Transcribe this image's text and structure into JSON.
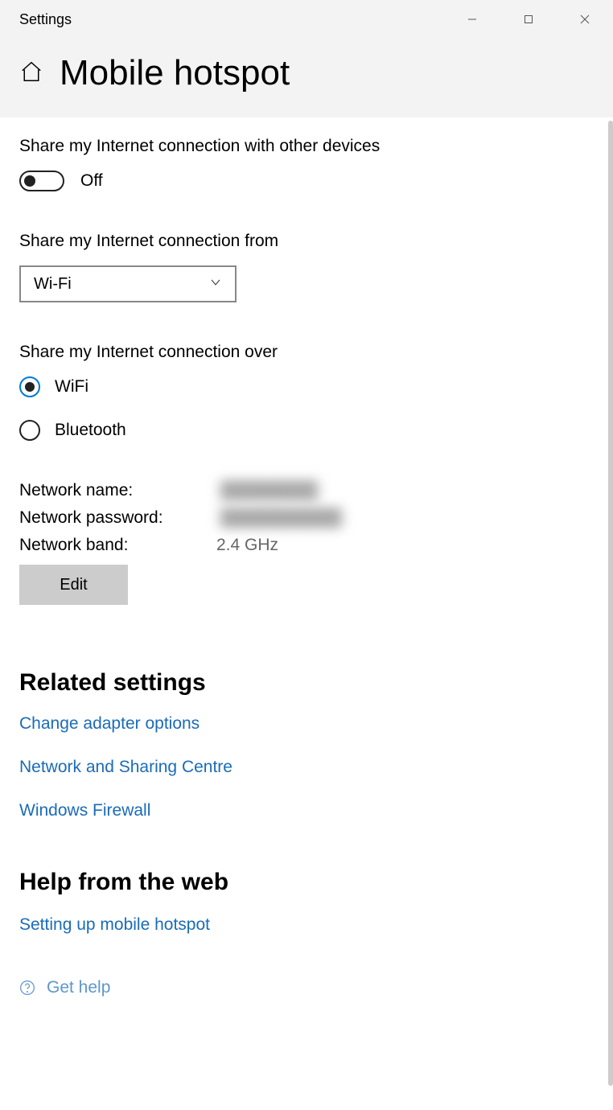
{
  "window_title": "Settings",
  "page_title": "Mobile hotspot",
  "share_with_devices": {
    "label": "Share my Internet connection with other devices",
    "toggle_state_label": "Off"
  },
  "share_from": {
    "label": "Share my Internet connection from",
    "selected": "Wi-Fi"
  },
  "share_over": {
    "label": "Share my Internet connection over",
    "options": [
      {
        "label": "WiFi",
        "selected": true
      },
      {
        "label": "Bluetooth",
        "selected": false
      }
    ]
  },
  "network": {
    "name_label": "Network name:",
    "name_value": "████████",
    "password_label": "Network password:",
    "password_value": "██████████",
    "band_label": "Network band:",
    "band_value": "2.4 GHz",
    "edit_label": "Edit"
  },
  "related": {
    "heading": "Related settings",
    "links": [
      "Change adapter options",
      "Network and Sharing Centre",
      "Windows Firewall"
    ]
  },
  "help": {
    "heading": "Help from the web",
    "links": [
      "Setting up mobile hotspot"
    ],
    "get_help_label": "Get help"
  }
}
